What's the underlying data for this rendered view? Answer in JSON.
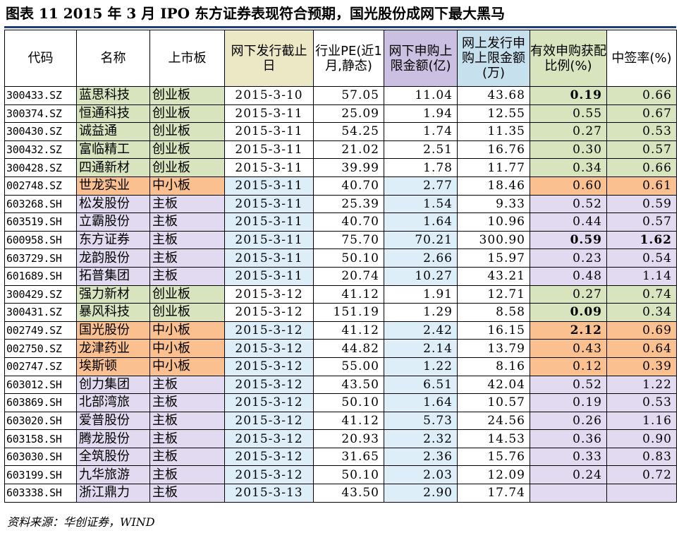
{
  "title": "图表 11    2015 年 3 月 IPO 东方证券表现符合预期，国光股份成网下最大黑马",
  "colors": {
    "chuangyeban": "#d7e4bd",
    "zhongxiaoban": "#fac090",
    "zhuban": "#e2daf0",
    "date_cell": "#ddeef8",
    "header_date": "#ece8c6",
    "header_purple": "#ccc0e2",
    "header_blue": "#c6e0ee",
    "header_green": "#d7e4bd",
    "title_rule": "#1f3e78"
  },
  "table": {
    "headers": [
      "代码",
      "名称",
      "上市板",
      "网下发行截止日",
      "行业PE(近1月,静态)",
      "网下申购上限金额(亿)",
      "网上发行申购上限金额(万)",
      "有效申购获配比例(%)",
      "中签率(%)"
    ],
    "rows": [
      {
        "code": "300433.SZ",
        "name": "蓝思科技",
        "board": "创业板",
        "date": "2015-3-10",
        "pe": "57.05",
        "offline": "11.04",
        "online": "43.68",
        "ratio": "0.19",
        "lottery": "0.66",
        "ratio_bold": true
      },
      {
        "code": "300374.SZ",
        "name": "恒通科技",
        "board": "创业板",
        "date": "2015-3-11",
        "pe": "25.09",
        "offline": "1.94",
        "online": "12.55",
        "ratio": "0.55",
        "lottery": "0.67"
      },
      {
        "code": "300430.SZ",
        "name": "诚益通",
        "board": "创业板",
        "date": "2015-3-11",
        "pe": "54.25",
        "offline": "1.74",
        "online": "11.35",
        "ratio": "0.27",
        "lottery": "0.53"
      },
      {
        "code": "300432.SZ",
        "name": "富临精工",
        "board": "创业板",
        "date": "2015-3-11",
        "pe": "21.02",
        "offline": "2.51",
        "online": "16.76",
        "ratio": "0.30",
        "lottery": "0.57"
      },
      {
        "code": "300428.SZ",
        "name": "四通新材",
        "board": "创业板",
        "date": "2015-3-11",
        "pe": "39.99",
        "offline": "1.78",
        "online": "11.77",
        "ratio": "0.34",
        "lottery": "0.66"
      },
      {
        "code": "002748.SZ",
        "name": "世龙实业",
        "board": "中小板",
        "date": "2015-3-11",
        "pe": "40.70",
        "offline": "2.77",
        "online": "18.46",
        "ratio": "0.60",
        "lottery": "0.61"
      },
      {
        "code": "603268.SH",
        "name": "松发股份",
        "board": "主板",
        "date": "2015-3-11",
        "pe": "25.39",
        "offline": "1.54",
        "online": "9.33",
        "ratio": "0.52",
        "lottery": "0.59"
      },
      {
        "code": "603519.SH",
        "name": "立霸股份",
        "board": "主板",
        "date": "2015-3-11",
        "pe": "40.70",
        "offline": "1.64",
        "online": "10.96",
        "ratio": "0.44",
        "lottery": "0.57"
      },
      {
        "code": "600958.SH",
        "name": "东方证券",
        "board": "主板",
        "date": "2015-3-11",
        "pe": "75.70",
        "offline": "70.21",
        "online": "300.90",
        "ratio": "0.59",
        "lottery": "1.62",
        "ratio_bold": true,
        "lottery_bold": true
      },
      {
        "code": "603729.SH",
        "name": "龙韵股份",
        "board": "主板",
        "date": "2015-3-11",
        "pe": "50.10",
        "offline": "2.66",
        "online": "15.97",
        "ratio": "0.23",
        "lottery": "0.54"
      },
      {
        "code": "601689.SH",
        "name": "拓普集团",
        "board": "主板",
        "date": "2015-3-11",
        "pe": "20.74",
        "offline": "10.27",
        "online": "43.21",
        "ratio": "0.48",
        "lottery": "1.14"
      },
      {
        "code": "300429.SZ",
        "name": "强力新材",
        "board": "创业板",
        "date": "2015-3-12",
        "pe": "41.12",
        "offline": "1.91",
        "online": "12.71",
        "ratio": "0.27",
        "lottery": "0.74"
      },
      {
        "code": "300431.SZ",
        "name": "暴风科技",
        "board": "创业板",
        "date": "2015-3-12",
        "pe": "151.19",
        "offline": "1.29",
        "online": "8.58",
        "ratio": "0.09",
        "lottery": "0.34",
        "ratio_bold": true
      },
      {
        "code": "002749.SZ",
        "name": "国光股份",
        "board": "中小板",
        "date": "2015-3-12",
        "pe": "41.12",
        "offline": "2.42",
        "online": "16.15",
        "ratio": "2.12",
        "lottery": "0.69",
        "ratio_bold": true
      },
      {
        "code": "002750.SZ",
        "name": "龙津药业",
        "board": "中小板",
        "date": "2015-3-12",
        "pe": "44.82",
        "offline": "2.14",
        "online": "13.79",
        "ratio": "0.43",
        "lottery": "0.64"
      },
      {
        "code": "002747.SZ",
        "name": "埃斯顿",
        "board": "中小板",
        "date": "2015-3-12",
        "pe": "55.00",
        "offline": "1.22",
        "online": "8.16",
        "ratio": "0.12",
        "lottery": "0.39"
      },
      {
        "code": "603012.SH",
        "name": "创力集团",
        "board": "主板",
        "date": "2015-3-12",
        "pe": "43.50",
        "offline": "6.51",
        "online": "42.04",
        "ratio": "0.52",
        "lottery": "1.22"
      },
      {
        "code": "603869.SH",
        "name": "北部湾旅",
        "board": "主板",
        "date": "2015-3-12",
        "pe": "50.10",
        "offline": "1.64",
        "online": "10.57",
        "ratio": "0.19",
        "lottery": "0.53"
      },
      {
        "code": "603020.SH",
        "name": "爱普股份",
        "board": "主板",
        "date": "2015-3-12",
        "pe": "41.12",
        "offline": "5.73",
        "online": "24.56",
        "ratio": "0.26",
        "lottery": "1.16"
      },
      {
        "code": "603158.SH",
        "name": "腾龙股份",
        "board": "主板",
        "date": "2015-3-12",
        "pe": "20.93",
        "offline": "2.32",
        "online": "14.53",
        "ratio": "0.36",
        "lottery": "0.90"
      },
      {
        "code": "603030.SH",
        "name": "全筑股份",
        "board": "主板",
        "date": "2015-3-12",
        "pe": "31.65",
        "offline": "2.36",
        "online": "15.76",
        "ratio": "0.33",
        "lottery": "0.83"
      },
      {
        "code": "603199.SH",
        "name": "九华旅游",
        "board": "主板",
        "date": "2015-3-12",
        "pe": "50.10",
        "offline": "2.03",
        "online": "12.09",
        "ratio": "0.24",
        "lottery": "0.72"
      },
      {
        "code": "603338.SH",
        "name": "浙江鼎力",
        "board": "主板",
        "date": "2015-3-13",
        "pe": "43.50",
        "offline": "2.90",
        "online": "17.74",
        "ratio": "",
        "lottery": ""
      }
    ]
  },
  "source": "资料来源：华创证券，WIND"
}
